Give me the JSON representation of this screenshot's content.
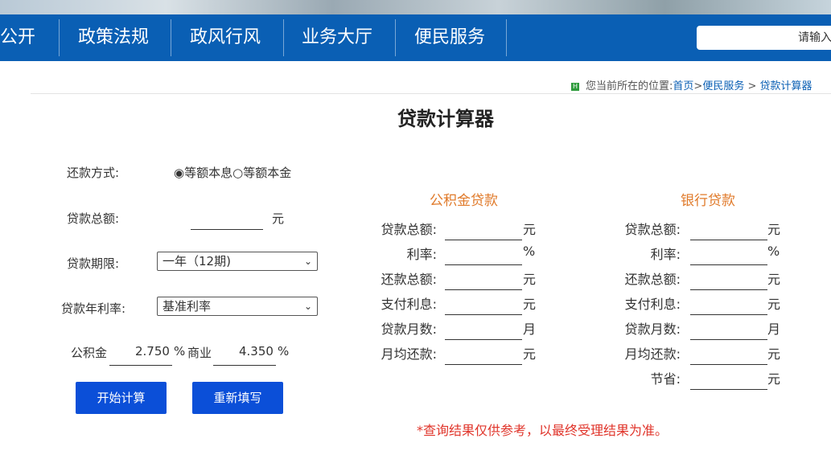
{
  "nav": {
    "items": [
      "公开",
      "政策法规",
      "政风行风",
      "业务大厅",
      "便民服务"
    ],
    "search_placeholder": "请输入"
  },
  "breadcrumb": {
    "prefix": "您当前所在的位置:",
    "home": "首页",
    "sep1": ">",
    "section": "便民服务",
    "sep2": ">",
    "page": "贷款计算器"
  },
  "page_title": "贷款计算器",
  "form": {
    "repay_method_label": "还款方式:",
    "repay_opt1": "等额本息",
    "repay_opt2": "等额本金",
    "total_label": "贷款总额:",
    "total_unit": "元",
    "term_label": "贷款期限:",
    "term_value": "一年（12期)",
    "rate_label": "贷款年利率:",
    "rate_value": "基准利率",
    "gjj_label": "公积金",
    "gjj_rate": "2.750",
    "percent": "%",
    "biz_label": "商业",
    "biz_rate": "4.350",
    "calc_button": "开始计算",
    "reset_button": "重新填写"
  },
  "results": {
    "gjj_title": "公积金贷款",
    "bank_title": "银行贷款",
    "rows": [
      {
        "label": "贷款总额:",
        "unit": "元"
      },
      {
        "label": "利率:",
        "unit": "%"
      },
      {
        "label": "还款总额:",
        "unit": "元"
      },
      {
        "label": "支付利息:",
        "unit": "元"
      },
      {
        "label": "贷款月数:",
        "unit": "月"
      },
      {
        "label": "月均还款:",
        "unit": "元"
      }
    ],
    "save_label": "节省:",
    "save_unit": "元"
  },
  "note": "*查询结果仅供参考，以最终受理结果为准。"
}
